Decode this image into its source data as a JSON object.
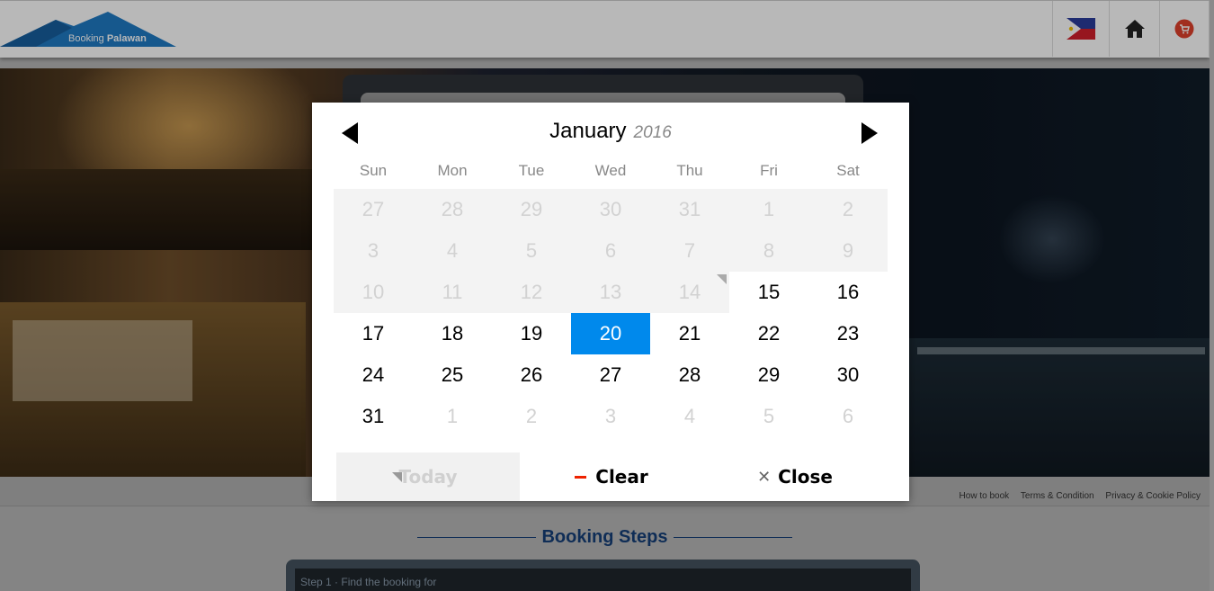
{
  "header": {
    "logo_text_prefix": "Booking",
    "logo_text_bold": "Palawan",
    "flag_icon": "philippines-flag-icon",
    "home_icon": "home-icon",
    "cart_icon": "cart-icon"
  },
  "footer_links": [
    "How to book",
    "Terms & Condition",
    "Privacy & Cookie Policy"
  ],
  "booking_steps": {
    "title": "Booking Steps",
    "first_step_text": "Step 1 · Find the booking for"
  },
  "datepicker": {
    "month": "January",
    "year": "2016",
    "weekdays": [
      "Sun",
      "Mon",
      "Tue",
      "Wed",
      "Thu",
      "Fri",
      "Sat"
    ],
    "weeks": [
      [
        {
          "d": "27",
          "s": "disabled"
        },
        {
          "d": "28",
          "s": "disabled"
        },
        {
          "d": "29",
          "s": "disabled"
        },
        {
          "d": "30",
          "s": "disabled"
        },
        {
          "d": "31",
          "s": "disabled"
        },
        {
          "d": "1",
          "s": "disabled"
        },
        {
          "d": "2",
          "s": "disabled"
        }
      ],
      [
        {
          "d": "3",
          "s": "disabled"
        },
        {
          "d": "4",
          "s": "disabled"
        },
        {
          "d": "5",
          "s": "disabled"
        },
        {
          "d": "6",
          "s": "disabled"
        },
        {
          "d": "7",
          "s": "disabled"
        },
        {
          "d": "8",
          "s": "disabled"
        },
        {
          "d": "9",
          "s": "disabled"
        }
      ],
      [
        {
          "d": "10",
          "s": "disabled"
        },
        {
          "d": "11",
          "s": "disabled"
        },
        {
          "d": "12",
          "s": "disabled"
        },
        {
          "d": "13",
          "s": "disabled"
        },
        {
          "d": "14",
          "s": "disabled today"
        },
        {
          "d": "15",
          "s": "enabled"
        },
        {
          "d": "16",
          "s": "enabled"
        }
      ],
      [
        {
          "d": "17",
          "s": "enabled"
        },
        {
          "d": "18",
          "s": "enabled"
        },
        {
          "d": "19",
          "s": "enabled"
        },
        {
          "d": "20",
          "s": "selected"
        },
        {
          "d": "21",
          "s": "enabled"
        },
        {
          "d": "22",
          "s": "enabled"
        },
        {
          "d": "23",
          "s": "enabled"
        }
      ],
      [
        {
          "d": "24",
          "s": "enabled"
        },
        {
          "d": "25",
          "s": "enabled"
        },
        {
          "d": "26",
          "s": "enabled"
        },
        {
          "d": "27",
          "s": "enabled"
        },
        {
          "d": "28",
          "s": "enabled"
        },
        {
          "d": "29",
          "s": "enabled"
        },
        {
          "d": "30",
          "s": "enabled"
        }
      ],
      [
        {
          "d": "31",
          "s": "enabled"
        },
        {
          "d": "1",
          "s": "outside"
        },
        {
          "d": "2",
          "s": "outside"
        },
        {
          "d": "3",
          "s": "outside"
        },
        {
          "d": "4",
          "s": "outside"
        },
        {
          "d": "5",
          "s": "outside"
        },
        {
          "d": "6",
          "s": "outside"
        }
      ]
    ],
    "buttons": {
      "today": "Today",
      "clear": "Clear",
      "close": "Close"
    },
    "colors": {
      "selected": "#0089ec",
      "clear_dash": "#ee2200"
    }
  }
}
